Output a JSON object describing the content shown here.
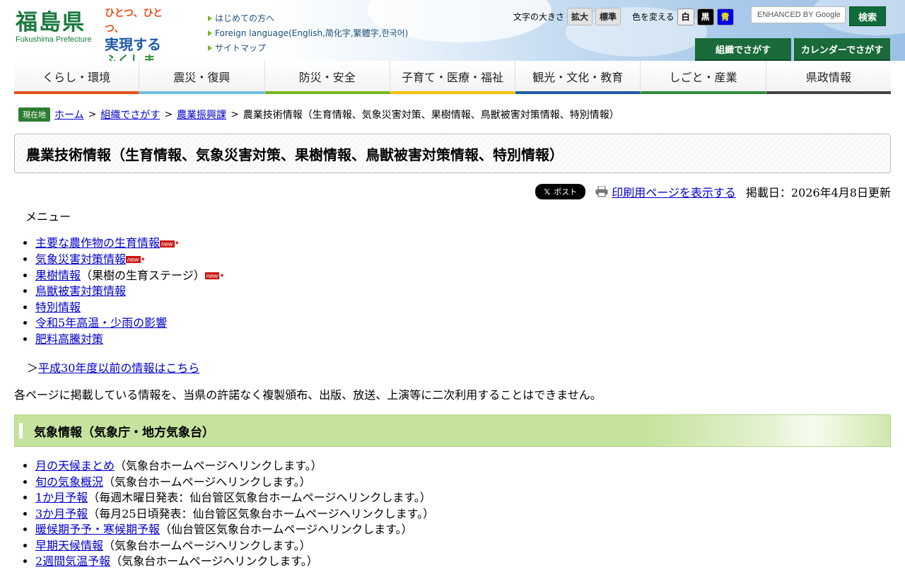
{
  "header": {
    "logo_kanji": "福島県",
    "logo_roman": "Fukushima Prefecture",
    "slogan": [
      "ひとつ、ひとつ、",
      "実現する",
      "ふくしま"
    ],
    "quick_links": [
      "はじめての方へ",
      "Foreign language(English,简化字,繁體字,한국어)",
      "サイトマップ"
    ],
    "text_size_label": "文字の大きさ",
    "enlarge_label": "拡大",
    "standard_label": "標準",
    "color_label": "色を変える",
    "color_white": "白",
    "color_black": "黒",
    "color_blue": "青",
    "search_placeholder": "ENHANCED BY Google",
    "search_button": "検索",
    "org_search": "組織でさがす",
    "calendar_search": "カレンダーでさがす"
  },
  "nav": [
    {
      "label": "くらし・環境",
      "color": "#e8501d"
    },
    {
      "label": "震災・復興",
      "color": "#6ec1e4"
    },
    {
      "label": "防災・安全",
      "color": "#7ab51d"
    },
    {
      "label": "子育て・医療・福祉",
      "color": "#f2c100"
    },
    {
      "label": "観光・文化・教育",
      "color": "#1e5aa8"
    },
    {
      "label": "しごと・産業",
      "color": "#2e8b3a"
    },
    {
      "label": "県政情報",
      "color": "#444444"
    }
  ],
  "breadcrumb": {
    "badge": "現在地",
    "home": "ホーム",
    "org": "組織でさがす",
    "dept": "農業振興課",
    "current": "農業技術情報（生育情報、気象災害対策、果樹情報、鳥獣被害対策情報、特別情報）"
  },
  "page_title": "農業技術情報（生育情報、気象災害対策、果樹情報、鳥獣被害対策情報、特別情報）",
  "meta": {
    "x_post": "ポスト",
    "print": "印刷用ページを表示する",
    "updated": "掲載日：2026年4月8日更新"
  },
  "menu_heading": "メニュー",
  "menu": [
    {
      "link": "主要な農作物の生育情報",
      "suffix": "",
      "new": true
    },
    {
      "link": "気象災害対策情報",
      "suffix": "",
      "new": true
    },
    {
      "link": "果樹情報",
      "suffix": "（果樹の生育ステージ）",
      "new": true
    },
    {
      "link": "鳥獣被害対策情報",
      "suffix": "",
      "new": false
    },
    {
      "link": "特別情報",
      "suffix": "",
      "new": false
    },
    {
      "link": "令和5年高温・少雨の影響",
      "suffix": "",
      "new": false
    },
    {
      "link": "肥料高騰対策",
      "suffix": "",
      "new": false
    }
  ],
  "new_badge": "new",
  "old_prefix": "＞",
  "old_link": "平成30年度以前の情報はこちら",
  "notice": "各ページに掲載している情報を、当県の許諾なく複製頒布、出版、放送、上演等に二次利用することはできません。",
  "section_title": "気象情報（気象庁・地方気象台）",
  "weather": [
    {
      "link": "月の天候まとめ",
      "note": "（気象台ホームページへリンクします。）"
    },
    {
      "link": "旬の気象概況",
      "note": "（気象台ホームページへリンクします。）"
    },
    {
      "link": "1か月予報",
      "note": "（毎週木曜日発表：仙台管区気象台ホームページへリンクします。）"
    },
    {
      "link": "3か月予報",
      "note": "（毎月25日頃発表：仙台管区気象台ホームページへリンクします。）"
    },
    {
      "link": "暖候期予予・寒候期予報",
      "note": "（仙台管区気象台ホームページへリンクします。）"
    },
    {
      "link": "早期天候情報",
      "note": "（気象台ホームページへリンクします。）"
    },
    {
      "link": "2週間気温予報",
      "note": "（気象台ホームページへリンクします。）"
    }
  ]
}
